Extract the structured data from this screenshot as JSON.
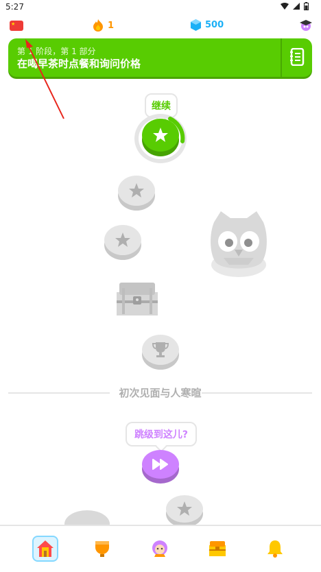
{
  "status_bar": {
    "time": "5:27"
  },
  "top_bar": {
    "flag_icon": "china-flag-icon",
    "streak_count": "1",
    "gems_count": "500",
    "streak_color": "#ff9600",
    "gems_color": "#1cb0f6"
  },
  "unit": {
    "subtitle": "第 1 阶段，第 1 部分",
    "title": "在喝早茶时点餐和询问价格",
    "color": "#58cc02"
  },
  "path": {
    "start_tooltip": "继续",
    "jump_tooltip": "跳级到这儿?"
  },
  "section_divider": {
    "label": "初次见面与人寒暄"
  },
  "bottom_nav": {
    "items": [
      "home-icon",
      "leagues-icon",
      "characters-icon",
      "chest-icon",
      "notifications-icon"
    ],
    "active": "home-icon"
  }
}
